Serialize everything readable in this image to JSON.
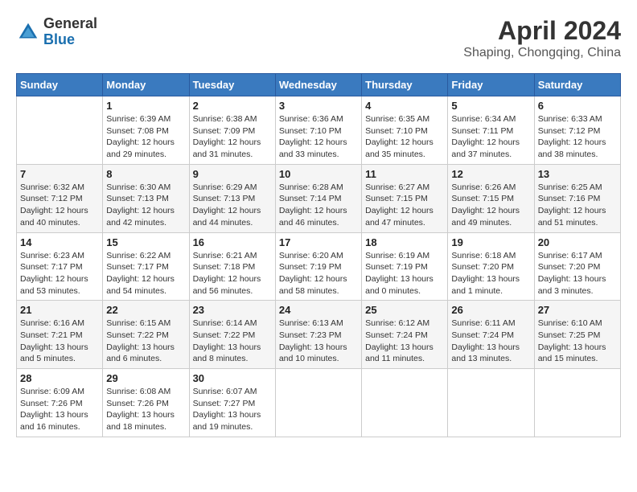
{
  "header": {
    "logo_general": "General",
    "logo_blue": "Blue",
    "title": "April 2024",
    "subtitle": "Shaping, Chongqing, China"
  },
  "weekdays": [
    "Sunday",
    "Monday",
    "Tuesday",
    "Wednesday",
    "Thursday",
    "Friday",
    "Saturday"
  ],
  "weeks": [
    [
      {
        "day": "",
        "sunrise": "",
        "sunset": "",
        "daylight": ""
      },
      {
        "day": "1",
        "sunrise": "Sunrise: 6:39 AM",
        "sunset": "Sunset: 7:08 PM",
        "daylight": "Daylight: 12 hours and 29 minutes."
      },
      {
        "day": "2",
        "sunrise": "Sunrise: 6:38 AM",
        "sunset": "Sunset: 7:09 PM",
        "daylight": "Daylight: 12 hours and 31 minutes."
      },
      {
        "day": "3",
        "sunrise": "Sunrise: 6:36 AM",
        "sunset": "Sunset: 7:10 PM",
        "daylight": "Daylight: 12 hours and 33 minutes."
      },
      {
        "day": "4",
        "sunrise": "Sunrise: 6:35 AM",
        "sunset": "Sunset: 7:10 PM",
        "daylight": "Daylight: 12 hours and 35 minutes."
      },
      {
        "day": "5",
        "sunrise": "Sunrise: 6:34 AM",
        "sunset": "Sunset: 7:11 PM",
        "daylight": "Daylight: 12 hours and 37 minutes."
      },
      {
        "day": "6",
        "sunrise": "Sunrise: 6:33 AM",
        "sunset": "Sunset: 7:12 PM",
        "daylight": "Daylight: 12 hours and 38 minutes."
      }
    ],
    [
      {
        "day": "7",
        "sunrise": "Sunrise: 6:32 AM",
        "sunset": "Sunset: 7:12 PM",
        "daylight": "Daylight: 12 hours and 40 minutes."
      },
      {
        "day": "8",
        "sunrise": "Sunrise: 6:30 AM",
        "sunset": "Sunset: 7:13 PM",
        "daylight": "Daylight: 12 hours and 42 minutes."
      },
      {
        "day": "9",
        "sunrise": "Sunrise: 6:29 AM",
        "sunset": "Sunset: 7:13 PM",
        "daylight": "Daylight: 12 hours and 44 minutes."
      },
      {
        "day": "10",
        "sunrise": "Sunrise: 6:28 AM",
        "sunset": "Sunset: 7:14 PM",
        "daylight": "Daylight: 12 hours and 46 minutes."
      },
      {
        "day": "11",
        "sunrise": "Sunrise: 6:27 AM",
        "sunset": "Sunset: 7:15 PM",
        "daylight": "Daylight: 12 hours and 47 minutes."
      },
      {
        "day": "12",
        "sunrise": "Sunrise: 6:26 AM",
        "sunset": "Sunset: 7:15 PM",
        "daylight": "Daylight: 12 hours and 49 minutes."
      },
      {
        "day": "13",
        "sunrise": "Sunrise: 6:25 AM",
        "sunset": "Sunset: 7:16 PM",
        "daylight": "Daylight: 12 hours and 51 minutes."
      }
    ],
    [
      {
        "day": "14",
        "sunrise": "Sunrise: 6:23 AM",
        "sunset": "Sunset: 7:17 PM",
        "daylight": "Daylight: 12 hours and 53 minutes."
      },
      {
        "day": "15",
        "sunrise": "Sunrise: 6:22 AM",
        "sunset": "Sunset: 7:17 PM",
        "daylight": "Daylight: 12 hours and 54 minutes."
      },
      {
        "day": "16",
        "sunrise": "Sunrise: 6:21 AM",
        "sunset": "Sunset: 7:18 PM",
        "daylight": "Daylight: 12 hours and 56 minutes."
      },
      {
        "day": "17",
        "sunrise": "Sunrise: 6:20 AM",
        "sunset": "Sunset: 7:19 PM",
        "daylight": "Daylight: 12 hours and 58 minutes."
      },
      {
        "day": "18",
        "sunrise": "Sunrise: 6:19 AM",
        "sunset": "Sunset: 7:19 PM",
        "daylight": "Daylight: 13 hours and 0 minutes."
      },
      {
        "day": "19",
        "sunrise": "Sunrise: 6:18 AM",
        "sunset": "Sunset: 7:20 PM",
        "daylight": "Daylight: 13 hours and 1 minute."
      },
      {
        "day": "20",
        "sunrise": "Sunrise: 6:17 AM",
        "sunset": "Sunset: 7:20 PM",
        "daylight": "Daylight: 13 hours and 3 minutes."
      }
    ],
    [
      {
        "day": "21",
        "sunrise": "Sunrise: 6:16 AM",
        "sunset": "Sunset: 7:21 PM",
        "daylight": "Daylight: 13 hours and 5 minutes."
      },
      {
        "day": "22",
        "sunrise": "Sunrise: 6:15 AM",
        "sunset": "Sunset: 7:22 PM",
        "daylight": "Daylight: 13 hours and 6 minutes."
      },
      {
        "day": "23",
        "sunrise": "Sunrise: 6:14 AM",
        "sunset": "Sunset: 7:22 PM",
        "daylight": "Daylight: 13 hours and 8 minutes."
      },
      {
        "day": "24",
        "sunrise": "Sunrise: 6:13 AM",
        "sunset": "Sunset: 7:23 PM",
        "daylight": "Daylight: 13 hours and 10 minutes."
      },
      {
        "day": "25",
        "sunrise": "Sunrise: 6:12 AM",
        "sunset": "Sunset: 7:24 PM",
        "daylight": "Daylight: 13 hours and 11 minutes."
      },
      {
        "day": "26",
        "sunrise": "Sunrise: 6:11 AM",
        "sunset": "Sunset: 7:24 PM",
        "daylight": "Daylight: 13 hours and 13 minutes."
      },
      {
        "day": "27",
        "sunrise": "Sunrise: 6:10 AM",
        "sunset": "Sunset: 7:25 PM",
        "daylight": "Daylight: 13 hours and 15 minutes."
      }
    ],
    [
      {
        "day": "28",
        "sunrise": "Sunrise: 6:09 AM",
        "sunset": "Sunset: 7:26 PM",
        "daylight": "Daylight: 13 hours and 16 minutes."
      },
      {
        "day": "29",
        "sunrise": "Sunrise: 6:08 AM",
        "sunset": "Sunset: 7:26 PM",
        "daylight": "Daylight: 13 hours and 18 minutes."
      },
      {
        "day": "30",
        "sunrise": "Sunrise: 6:07 AM",
        "sunset": "Sunset: 7:27 PM",
        "daylight": "Daylight: 13 hours and 19 minutes."
      },
      {
        "day": "",
        "sunrise": "",
        "sunset": "",
        "daylight": ""
      },
      {
        "day": "",
        "sunrise": "",
        "sunset": "",
        "daylight": ""
      },
      {
        "day": "",
        "sunrise": "",
        "sunset": "",
        "daylight": ""
      },
      {
        "day": "",
        "sunrise": "",
        "sunset": "",
        "daylight": ""
      }
    ]
  ]
}
